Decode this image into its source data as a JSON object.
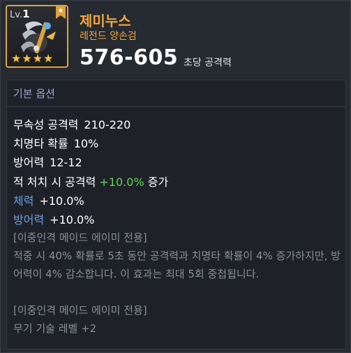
{
  "item": {
    "level_prefix": "Lv.",
    "level": "1",
    "name": "제미누스",
    "grade": "레전드 양손검",
    "attack_range": "576-605",
    "attack_label": "초당 공격력",
    "stars": 4,
    "icon": "two-handed-sword-item-icon",
    "frame_color": "#e0a23a"
  },
  "options": {
    "section_title": "기본 옵션",
    "stats": [
      {
        "label": "무속성 공격력",
        "value": "210-220"
      },
      {
        "label": "치명타 확률",
        "value": "10%"
      },
      {
        "label": "방어력",
        "value": "12-12"
      }
    ],
    "kill_bonus": {
      "prefix": "적 처치 시 공격력",
      "value": "+10.0%",
      "suffix": "증가"
    },
    "bonus_stats": [
      {
        "label": "체력",
        "value": "+10.0%"
      },
      {
        "label": "방어력",
        "value": "+10.0%"
      }
    ],
    "exclusive_1": {
      "tag": "[이중인격 메이드 에이미 전용]",
      "text": "적중 시 40% 확률로 5초 동안 공격력과 치명타 확률이 4% 증가하지만, 방어력이 4% 감소합니다. 이 효과는 최대 5회 중첩됩니다."
    },
    "exclusive_2": {
      "tag": "[이중인격 메이드 에이미 전용]",
      "text": "무기 기술 레벨 +2"
    }
  },
  "colors": {
    "name": "#f2a83a",
    "label_blue": "#6aa0e8",
    "bonus_green": "#5fd35c",
    "desc_gray": "#8a8f99"
  }
}
